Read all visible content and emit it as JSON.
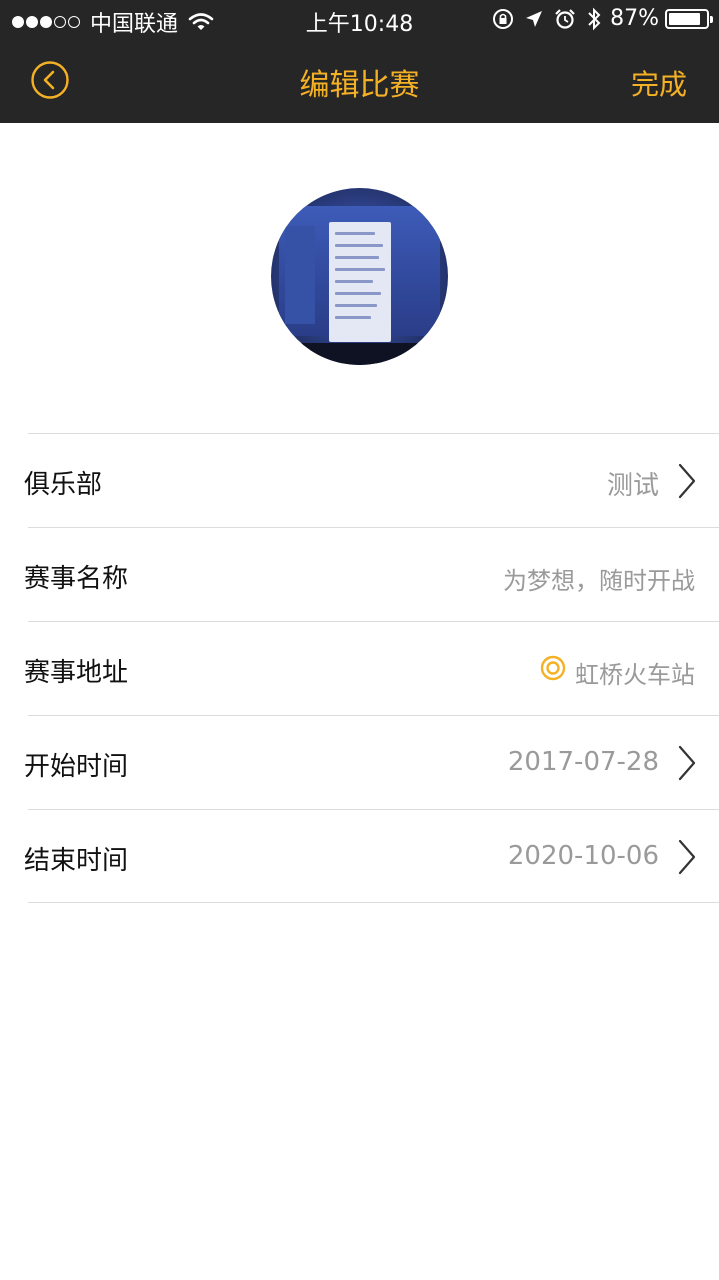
{
  "status_bar": {
    "carrier": "中国联通",
    "time": "上午10:48",
    "battery": "87%",
    "battery_level": 0.87,
    "icons": [
      "wifi-icon",
      "rotation-lock-icon",
      "location-arrow-icon",
      "alarm-icon",
      "bluetooth-icon",
      "battery-icon"
    ]
  },
  "nav": {
    "title": "编辑比赛",
    "done_label": "完成",
    "accent_color": "#f5b125",
    "bar_color": "#262626"
  },
  "form": {
    "rows": [
      {
        "label": "俱乐部",
        "value": "测试"
      },
      {
        "label": "赛事名称",
        "placeholder": "为梦想，随时开战"
      },
      {
        "label": "赛事地址",
        "value": "虹桥火车站"
      },
      {
        "label": "开始时间",
        "value": "2017-07-28"
      },
      {
        "label": "结束时间",
        "value": "2020-10-06"
      }
    ]
  }
}
